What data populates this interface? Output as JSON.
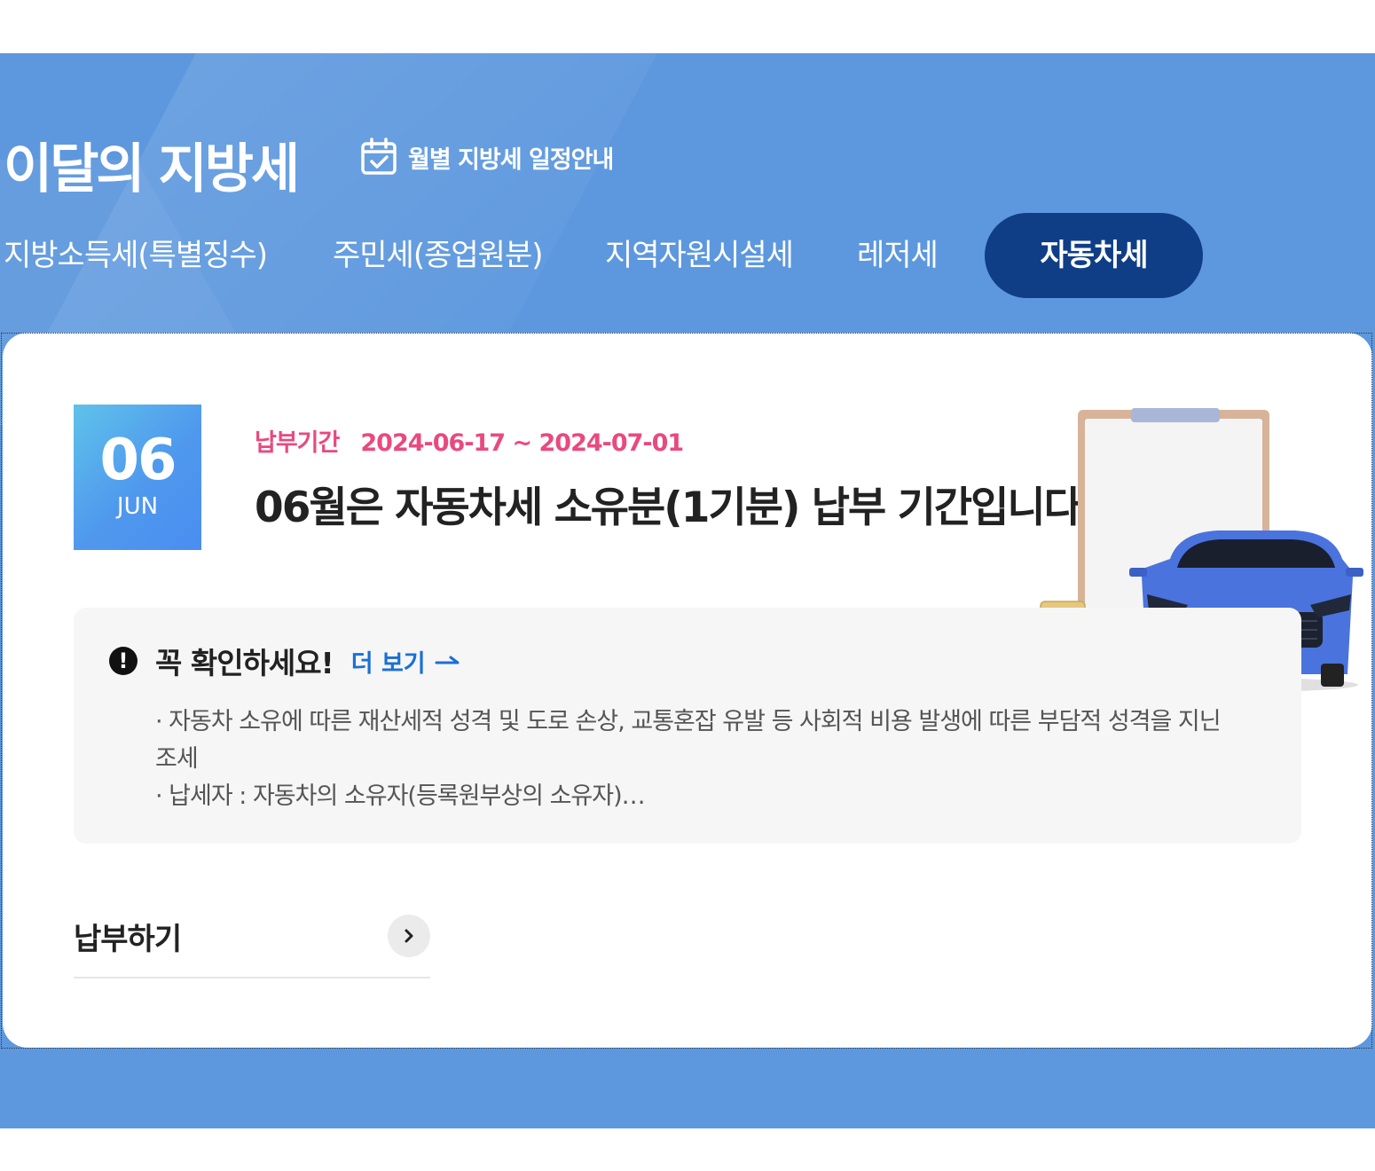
{
  "header": {
    "title": "이달의 지방세",
    "schedule_link": {
      "label": "월별 지방세 일정안내",
      "icon": "calendar-check-icon"
    }
  },
  "tabs": [
    {
      "label": "지방소득세(특별징수)",
      "active": false
    },
    {
      "label": "주민세(종업원분)",
      "active": false
    },
    {
      "label": "지역자원시설세",
      "active": false
    },
    {
      "label": "레저세",
      "active": false
    },
    {
      "label": "자동차세",
      "active": true
    }
  ],
  "card": {
    "date": {
      "day": "06",
      "month": "JUN"
    },
    "period": {
      "label": "납부기간",
      "value": "2024-06-17 ~ 2024-07-01"
    },
    "headline": "06월은 자동차세 소유분(1기분) 납부 기간입니다",
    "illustration": "car-clipboard-coins-illustration",
    "notice": {
      "icon": "alert-icon",
      "title": "꼭 확인하세요!",
      "more_label": "더 보기",
      "lines": [
        "· 자동차 소유에 따른 재산세적 성격 및 도로 손상, 교통혼잡 유발 등 사회적 비용 발생에 따른 부담적 성격을 지닌 조세",
        "· 납세자 : 자동차의 소유자(등록원부상의 소유자)…"
      ]
    },
    "pay_label": "납부하기"
  },
  "colors": {
    "banner": "#5d98de",
    "active_tab": "#0f3e86",
    "period": "#e84a7f",
    "more_link": "#1a6fd6"
  }
}
